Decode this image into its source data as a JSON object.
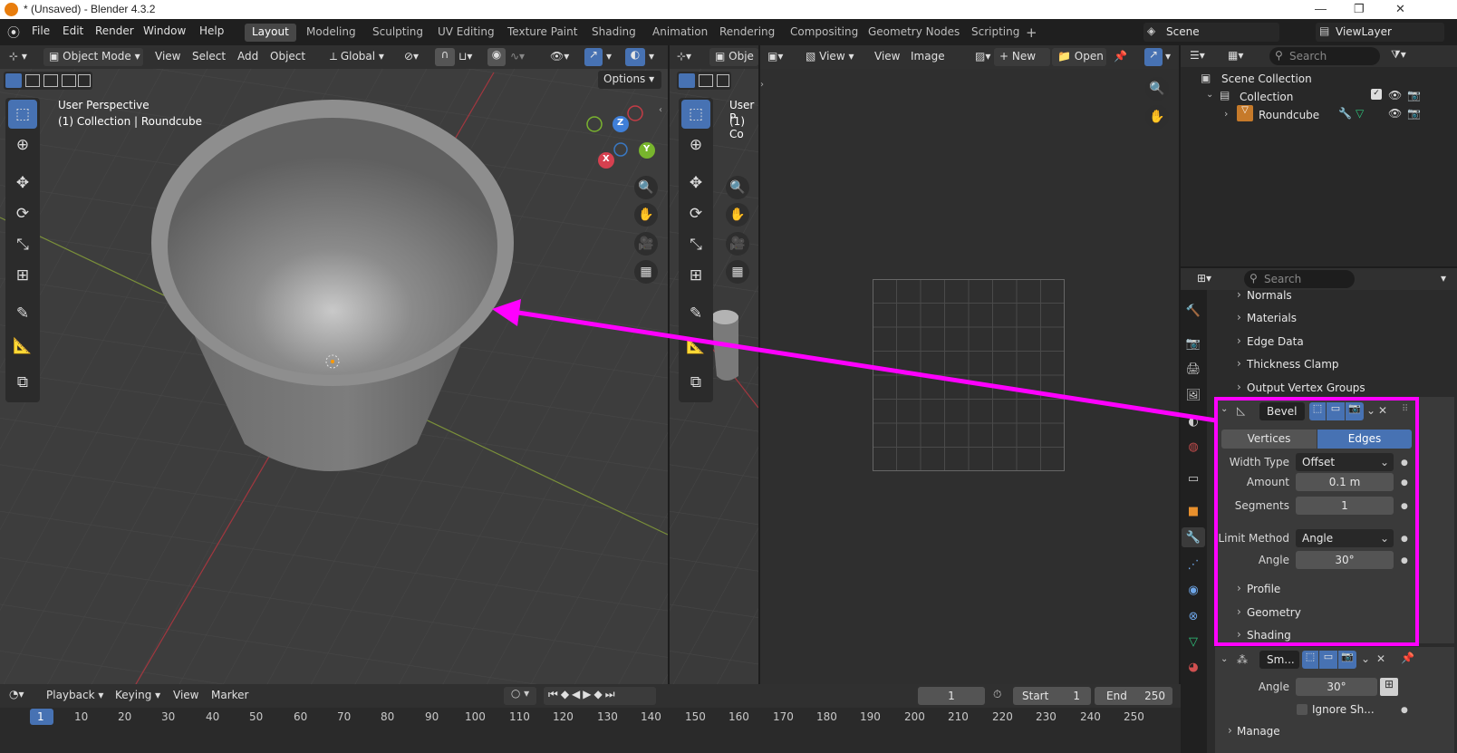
{
  "window": {
    "title": "* (Unsaved) - Blender 4.3.2"
  },
  "menu": [
    "File",
    "Edit",
    "Render",
    "Window",
    "Help"
  ],
  "workspaces": [
    "Layout",
    "Modeling",
    "Sculpting",
    "UV Editing",
    "Texture Paint",
    "Shading",
    "Animation",
    "Rendering",
    "Compositing",
    "Geometry Nodes",
    "Scripting"
  ],
  "scene": {
    "name": "Scene",
    "view_layer": "ViewLayer"
  },
  "viewport": {
    "mode": "Object Mode",
    "menus": [
      "View",
      "Select",
      "Add",
      "Object"
    ],
    "orientation": "Global",
    "options_label": "Options",
    "overlay_line1": "User Perspective",
    "overlay_line2": "(1) Collection | Roundcube",
    "overlay2_line1": "User P",
    "overlay2_line2": "(1) Co",
    "mode2": "Obje"
  },
  "image_editor": {
    "menus": [
      "View",
      "View",
      "Image"
    ],
    "new_label": "New",
    "open_label": "Open"
  },
  "outliner": {
    "search_placeholder": "Search",
    "root": "Scene Collection",
    "collection": "Collection",
    "object": "Roundcube"
  },
  "properties": {
    "search_placeholder": "Search",
    "sections": [
      "Normals",
      "Materials",
      "Edge Data",
      "Thickness Clamp",
      "Output Vertex Groups"
    ],
    "bevel": {
      "name": "Bevel",
      "tab_vertices": "Vertices",
      "tab_edges": "Edges",
      "width_type_label": "Width Type",
      "width_type": "Offset",
      "amount_label": "Amount",
      "amount": "0.1 m",
      "segments_label": "Segments",
      "segments": "1",
      "limit_method_label": "Limit Method",
      "limit_method": "Angle",
      "angle_label": "Angle",
      "angle": "30°",
      "subsections": [
        "Profile",
        "Geometry",
        "Shading"
      ]
    },
    "smooth": {
      "name": "Sm...",
      "angle_label": "Angle",
      "angle": "30°",
      "ignore_label": "Ignore Sh...",
      "manage_label": "Manage"
    },
    "highlight_color": "#ff00ff"
  },
  "timeline": {
    "menus": [
      "Playback",
      "Keying",
      "View",
      "Marker"
    ],
    "current_frame": "1",
    "start_label": "Start",
    "start": "1",
    "end_label": "End",
    "end": "250",
    "ticks": [
      "1",
      "10",
      "20",
      "30",
      "40",
      "50",
      "60",
      "70",
      "80",
      "90",
      "100",
      "110",
      "120",
      "130",
      "140",
      "150",
      "160",
      "170",
      "180",
      "190",
      "200",
      "210",
      "220",
      "230",
      "240",
      "250"
    ]
  },
  "gizmo": {
    "x": "X",
    "y": "Y",
    "z": "Z"
  }
}
